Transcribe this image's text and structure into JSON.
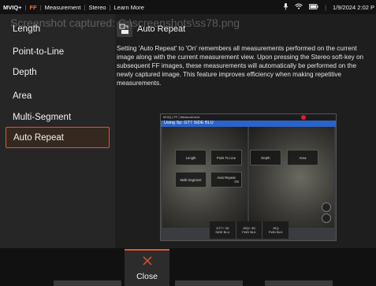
{
  "status_bar": {
    "app": "MVIQ+",
    "mode": "FF",
    "crumbs": [
      "Measurement",
      "Stereo",
      "Learn More"
    ],
    "date": "1/9/2024 2:02 P"
  },
  "watermark": "Screenshot captured: C:\\screenshots\\ss78.png",
  "sidebar": {
    "items": [
      {
        "label": "Length"
      },
      {
        "label": "Point-to-Line"
      },
      {
        "label": "Depth"
      },
      {
        "label": "Area"
      },
      {
        "label": "Multi-Segment"
      },
      {
        "label": "Auto Repeat"
      }
    ],
    "selected": "Auto Repeat"
  },
  "content": {
    "title": "Auto Repeat",
    "description": "Setting 'Auto Repeat' to 'On' remembers all measurements performed on the current image along with the current measurement view. Upon pressing the Stereo soft-key on subsequent FF images, these measurements will automatically be performed on the newly captured image. This feature improves efficiency when making repetitive measurements."
  },
  "example_image": {
    "top_text": "MVIQ | FF | Measurement",
    "sub_text": "Using Sp: GT7     SIDE BLU",
    "menu": {
      "length": "Length",
      "point_to_line": "Point To Line",
      "depth": "Depth",
      "area": "Area",
      "multi_segment": "Multi-Segment",
      "auto_repeat": "Auto Repeat",
      "auto_repeat_state": "On"
    },
    "softkeys": [
      {
        "line1": "GT7+ 3D",
        "line2": "SIDE BLU"
      },
      {
        "line1": "JSQ+ 3D",
        "line2": "FWD BLK"
      },
      {
        "line1": "JSQ",
        "line2": "FWD BLK"
      }
    ]
  },
  "bottom": {
    "close_label": "Close"
  },
  "colors": {
    "accent": "#e2552a",
    "ff": "#f07a2a",
    "blue_bar": "#2b63c9"
  }
}
